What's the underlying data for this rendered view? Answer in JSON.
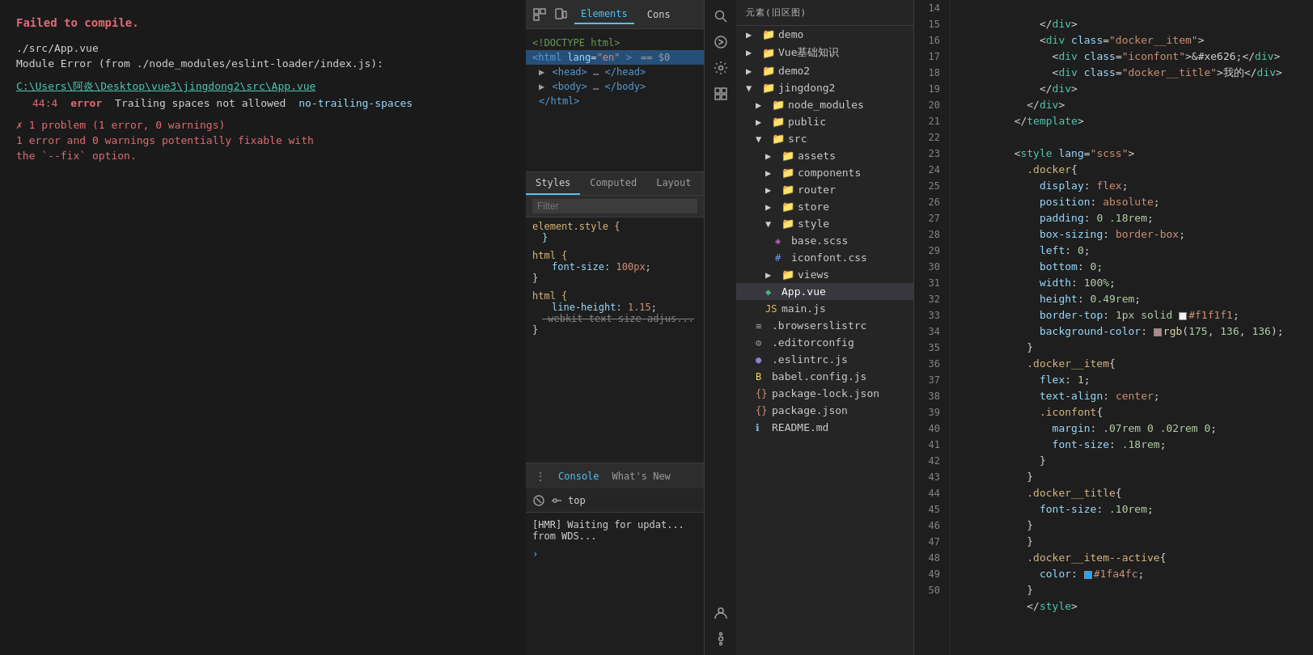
{
  "leftPanel": {
    "errorMain": "Failed to compile.",
    "blankLine": "",
    "path1": "./src/App.vue",
    "path2": "Module Error (from ./node_modules/eslint-loader/index.js):",
    "blankLine2": "",
    "fileLink": "C:\\Users\\阿炎\\Desktop\\vue3\\jingdong2\\src\\App.vue",
    "errorDetail": "  44:4  error  Trailing spaces not allowed  no-trailing-spaces",
    "blankLine3": "",
    "summary1": "✗ 1 problem (1 error, 0 warnings)",
    "summary2": "  1 error and 0 warnings potentially fixable with",
    "summary3": "  the `--fix` option."
  },
  "devtools": {
    "topTabs": [
      "Elements",
      "Cons"
    ],
    "icons": [
      "inspect",
      "device",
      "search"
    ],
    "domNodes": [
      {
        "indent": 0,
        "text": "<!DOCTYPE html>",
        "type": "comment"
      },
      {
        "indent": 0,
        "text": "<html lang=\"en\"> == $0",
        "type": "tag",
        "selected": true
      },
      {
        "indent": 1,
        "text": "▶ <head>…</head>",
        "type": "tag"
      },
      {
        "indent": 1,
        "text": "▶ <body>…</body>",
        "type": "tag"
      },
      {
        "indent": 1,
        "text": "</html>",
        "type": "tag"
      }
    ],
    "styleTabs": [
      "Styles",
      "Computed",
      "Layout"
    ],
    "activeStyleTab": "Styles",
    "filterPlaceholder": "Filter",
    "styleRules": [
      {
        "selector": "element.style {",
        "properties": [
          {
            "name": "}",
            "value": ""
          }
        ]
      },
      {
        "selector": "html {",
        "properties": [
          {
            "name": "  font-size:",
            "value": "100px;"
          }
        ]
      },
      {
        "selector": "}",
        "properties": []
      },
      {
        "selector": "html {",
        "properties": [
          {
            "name": "  line-height:",
            "value": "1.15;"
          },
          {
            "name": "  -webkit-text-size-adjus",
            "value": ""
          }
        ]
      },
      {
        "selector": "}",
        "properties": []
      }
    ],
    "consoleTabs": [
      {
        "label": "⋮",
        "type": "menu"
      },
      {
        "label": "Console",
        "active": true
      },
      {
        "label": "What's New"
      }
    ],
    "consoleToolbar": {
      "clearIcon": "🚫",
      "topLabel": "top"
    },
    "consoleMessages": [
      "[HMR] Waiting for updat...",
      "from WDS..."
    ],
    "chevronExpand": "›"
  },
  "fileExplorer": {
    "header": "元素(旧区图)",
    "items": [
      {
        "name": "demo",
        "type": "folder",
        "indent": 1
      },
      {
        "name": "Vue基础知识",
        "type": "folder",
        "indent": 1
      },
      {
        "name": "demo2",
        "type": "folder",
        "indent": 1
      },
      {
        "name": "jingdong2",
        "type": "folder",
        "indent": 1,
        "expanded": true
      },
      {
        "name": "node_modules",
        "type": "folder",
        "indent": 2
      },
      {
        "name": "public",
        "type": "folder",
        "indent": 2
      },
      {
        "name": "src",
        "type": "folder",
        "indent": 2,
        "expanded": true
      },
      {
        "name": "assets",
        "type": "folder",
        "indent": 3
      },
      {
        "name": "components",
        "type": "folder",
        "indent": 3
      },
      {
        "name": "router",
        "type": "folder",
        "indent": 3
      },
      {
        "name": "store",
        "type": "folder",
        "indent": 3
      },
      {
        "name": "style",
        "type": "folder",
        "indent": 3,
        "expanded": true
      },
      {
        "name": "base.scss",
        "type": "scss",
        "indent": 4
      },
      {
        "name": "iconfont.css",
        "type": "css",
        "indent": 4
      },
      {
        "name": "views",
        "type": "folder",
        "indent": 3
      },
      {
        "name": "App.vue",
        "type": "vue",
        "indent": 3,
        "active": true
      },
      {
        "name": "main.js",
        "type": "js",
        "indent": 3
      },
      {
        "name": ".browserslistrc",
        "type": "file",
        "indent": 2
      },
      {
        "name": ".editorconfig",
        "type": "gear",
        "indent": 2
      },
      {
        "name": ".eslintrc.js",
        "type": "eslint",
        "indent": 2
      },
      {
        "name": "babel.config.js",
        "type": "babel",
        "indent": 2
      },
      {
        "name": "package-lock.json",
        "type": "json",
        "indent": 2
      },
      {
        "name": "package.json",
        "type": "json",
        "indent": 2
      },
      {
        "name": "README.md",
        "type": "info",
        "indent": 2
      }
    ]
  },
  "codeEditor": {
    "startLine": 14,
    "lines": [
      {
        "num": 14,
        "content": "    </div>"
      },
      {
        "num": 15,
        "content": "    <div class=\"docker__item\">"
      },
      {
        "num": 16,
        "content": "      <div class=\"iconfont\">&#xe626;</div>"
      },
      {
        "num": 17,
        "content": "      <div class=\"docker__title\">我的</div>"
      },
      {
        "num": 18,
        "content": "    </div>"
      },
      {
        "num": 19,
        "content": "  </div>"
      },
      {
        "num": 20,
        "content": "</template>"
      },
      {
        "num": 21,
        "content": ""
      },
      {
        "num": 22,
        "content": "<style lang=\"scss\">"
      },
      {
        "num": 23,
        "content": "  .docker{"
      },
      {
        "num": 24,
        "content": "    display: flex;"
      },
      {
        "num": 25,
        "content": "    position: absolute;"
      },
      {
        "num": 26,
        "content": "    padding: 0 .18rem;"
      },
      {
        "num": 27,
        "content": "    box-sizing: border-box;"
      },
      {
        "num": 28,
        "content": "    left: 0;"
      },
      {
        "num": 29,
        "content": "    bottom: 0;"
      },
      {
        "num": 30,
        "content": "    width: 100%;"
      },
      {
        "num": 31,
        "content": "    height: 0.49rem;"
      },
      {
        "num": 32,
        "content": "    border-top: 1px solid □#f1f1f1;"
      },
      {
        "num": 33,
        "content": "    background-color: □rgb(175, 136, 136);"
      },
      {
        "num": 34,
        "content": "  }"
      },
      {
        "num": 35,
        "content": "  .docker__item{"
      },
      {
        "num": 36,
        "content": "    flex: 1;"
      },
      {
        "num": 37,
        "content": "    text-align: center;"
      },
      {
        "num": 38,
        "content": "    .iconfont{"
      },
      {
        "num": 39,
        "content": "      margin: .07rem 0 .02rem 0;"
      },
      {
        "num": 40,
        "content": "      font-size: .18rem;"
      },
      {
        "num": 41,
        "content": "    }"
      },
      {
        "num": 42,
        "content": "  }"
      },
      {
        "num": 43,
        "content": "  .docker__title{"
      },
      {
        "num": 44,
        "content": "    font-size: .10rem;"
      },
      {
        "num": 45,
        "content": "  }"
      },
      {
        "num": 46,
        "content": "  }"
      },
      {
        "num": 47,
        "content": "  .docker__item--active{"
      },
      {
        "num": 48,
        "content": "    color: □#1fa4fc;"
      },
      {
        "num": 49,
        "content": "  }"
      },
      {
        "num": 50,
        "content": "  </style>"
      }
    ]
  }
}
